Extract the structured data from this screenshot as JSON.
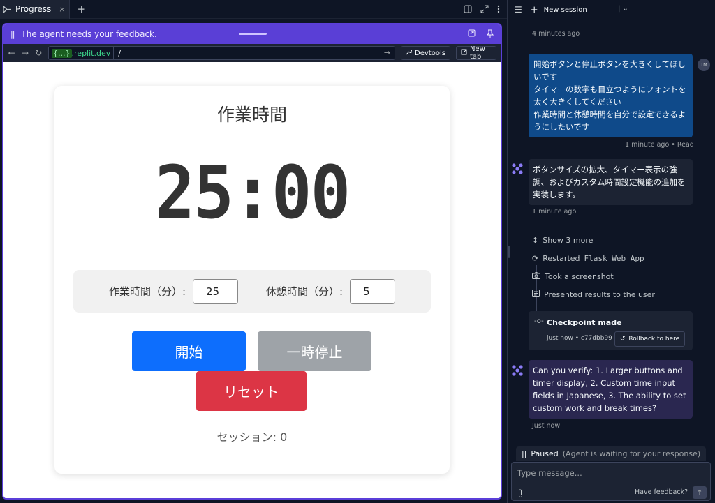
{
  "tabbar": {
    "tab_label": "Progress",
    "close_glyph": "×",
    "add_glyph": "+"
  },
  "feedback_bar": {
    "message": "The agent needs your feedback.",
    "pause_glyph": "||"
  },
  "url_bar": {
    "domain_prefix": "{...}",
    "domain": ".replit.dev",
    "path": "/",
    "devtools_label": "Devtools",
    "new_tab_label": "New tab"
  },
  "webpage": {
    "title": "作業時間",
    "timer": "25:00",
    "work_label": "作業時間（分）:",
    "work_value": "25",
    "break_label": "休憩時間（分）:",
    "break_value": "5",
    "start_label": "開始",
    "pause_label": "一時停止",
    "reset_label": "リセット",
    "sessions_text": "セッション: 0"
  },
  "chat": {
    "new_session_label": "New session",
    "time_1": "4 minutes ago",
    "user_message": "開始ボタンと停止ボタンを大きくしてほしいです\nタイマーの数字も目立つようにフォントを太く大きくしてください\n作業時間と休憩時間を自分で設定できるようにしたいです",
    "user_initials": "TM",
    "user_time": "1 minute ago",
    "read_status": "Read",
    "agent_message_1": "ボタンサイズの拡大、タイマー表示の強調、およびカスタム時間設定機能の追加を実装します。",
    "agent_time_1": "1 minute ago",
    "show_more": "Show 3 more",
    "action_restart_prefix": "Restarted",
    "action_restart_target": "Flask Web App",
    "action_screenshot": "Took a screenshot",
    "action_presented": "Presented results to the user",
    "checkpoint_title": "Checkpoint made",
    "checkpoint_time": "just now",
    "checkpoint_hash": "c77dbb99",
    "rollback_label": "Rollback to here",
    "agent_message_2": "Can you verify: 1. Larger buttons and timer display, 2. Custom time input fields in Japanese, 3. The ability to set custom work and break times?",
    "agent_time_2": "Just now",
    "paused_label": "Paused",
    "paused_sub": "(Agent is waiting for your response)",
    "composer_placeholder": "Type message...",
    "feedback_link": "Have feedback?"
  },
  "colors": {
    "ide_bg": "#0e1525",
    "panel_bg": "#1c2333",
    "accent_purple": "#5a3fd6",
    "user_bubble": "#0f4a8a",
    "start_button": "#0d6efd",
    "pause_button": "#9ea3a8",
    "reset_button": "#dc3545"
  },
  "icons": [
    "progress-icon",
    "split-view-icon",
    "expand-icon",
    "more-vertical-icon",
    "back-icon",
    "forward-icon",
    "reload-icon",
    "wrench-icon",
    "external-link-icon",
    "list-icon",
    "plus-icon",
    "chevron-down-icon",
    "agent-icon",
    "show-more-icon",
    "restart-icon",
    "camera-icon",
    "checklist-icon",
    "checkpoint-icon",
    "rollback-icon",
    "attach-icon",
    "send-icon",
    "pin-icon",
    "popout-icon"
  ]
}
